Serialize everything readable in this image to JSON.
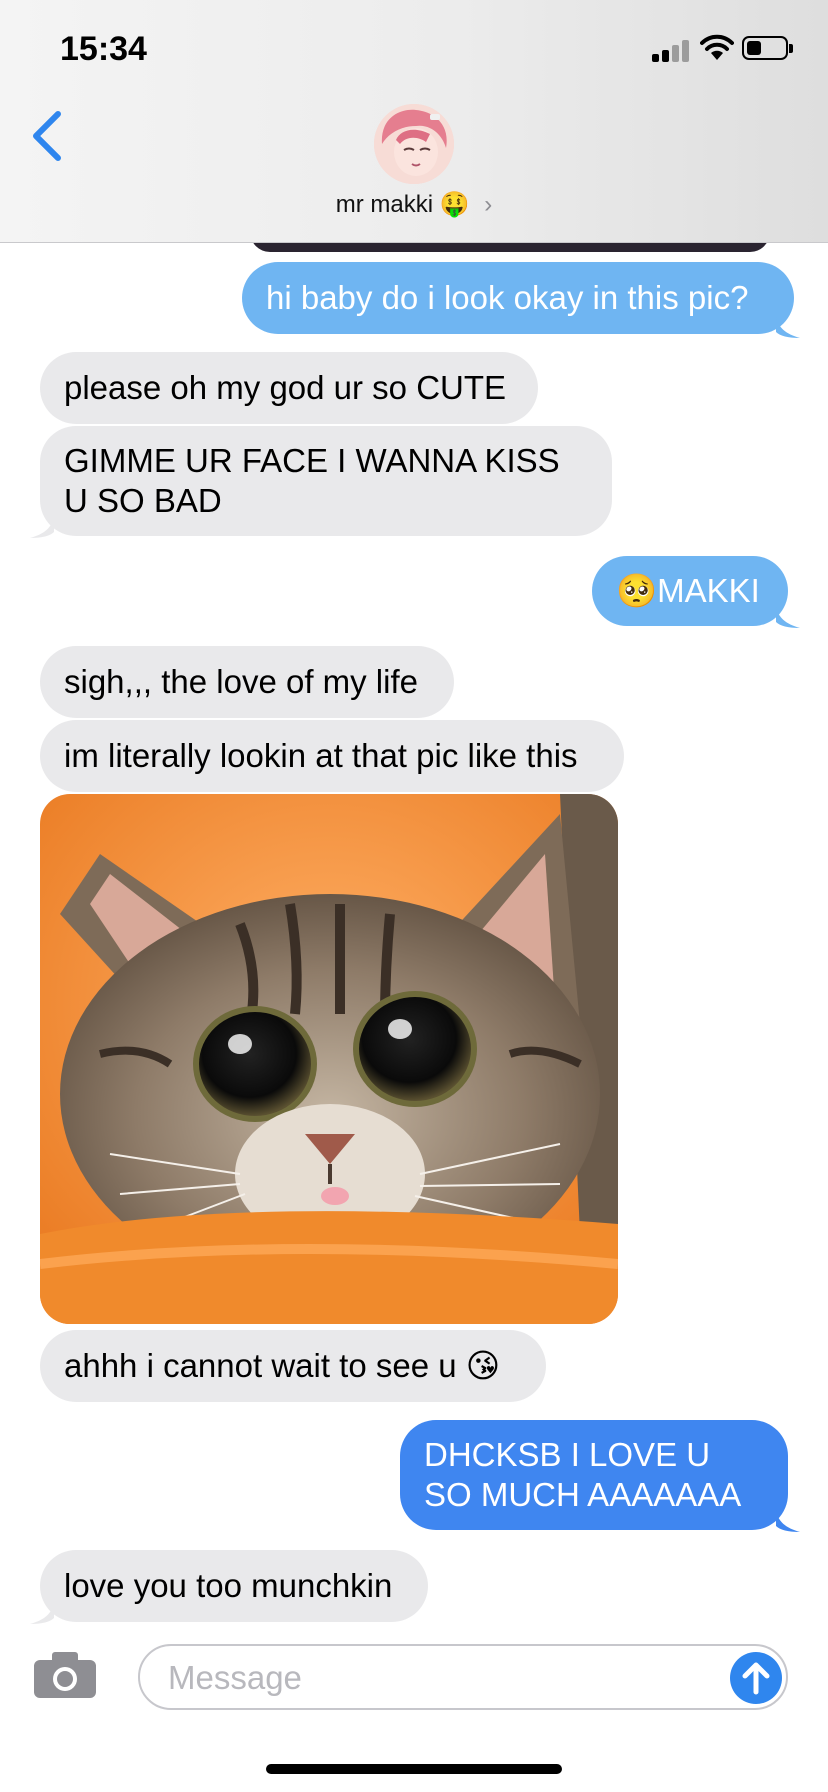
{
  "status_bar": {
    "time": "15:34"
  },
  "header": {
    "contact_name": "mr makki",
    "name_emoji": "🤑",
    "chevron": "›"
  },
  "messages": [
    {
      "side": "sent",
      "text": "hi baby do i look okay in this pic?"
    },
    {
      "side": "received",
      "text": "please oh my god ur so CUTE"
    },
    {
      "side": "received",
      "text": "GIMME UR FACE I WANNA KISS U SO BAD"
    },
    {
      "side": "sent",
      "text": "🥺MAKKI"
    },
    {
      "side": "received",
      "text": "sigh,,, the love of my life"
    },
    {
      "side": "received",
      "text": "im literally lookin at that pic like this"
    },
    {
      "side": "received",
      "type": "image",
      "subject": "kitten-photo"
    },
    {
      "side": "received",
      "text": "ahhh i cannot wait to see u 😘"
    },
    {
      "side": "sent",
      "text": "DHCKSB I LOVE U SO MUCH AAAAAAA"
    },
    {
      "side": "received",
      "text": "love you too munchkin"
    }
  ],
  "composer": {
    "placeholder": "Message"
  },
  "icons": [
    "back-chevron-icon",
    "camera-icon",
    "send-arrow-icon",
    "signal-icon",
    "wifi-icon",
    "battery-icon"
  ],
  "colors": {
    "received_bubble": "#e9e9eb",
    "sent_bubble_light": "#6fb5f2",
    "sent_bubble": "#3f86f0",
    "accent": "#2f86ee"
  }
}
